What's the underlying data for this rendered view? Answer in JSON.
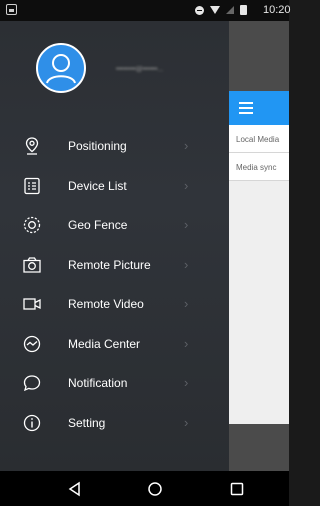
{
  "status_bar": {
    "time": "10:20"
  },
  "drawer": {
    "account": "••••••••@••••••...",
    "menu": [
      {
        "label": "Positioning",
        "icon": "location-pin-icon"
      },
      {
        "label": "Device List",
        "icon": "device-list-icon"
      },
      {
        "label": "Geo Fence",
        "icon": "geo-fence-icon"
      },
      {
        "label": "Remote Picture",
        "icon": "camera-icon"
      },
      {
        "label": "Remote Video",
        "icon": "video-icon"
      },
      {
        "label": "Media Center",
        "icon": "media-center-icon"
      },
      {
        "label": "Notification",
        "icon": "notification-icon"
      },
      {
        "label": "Setting",
        "icon": "info-icon"
      }
    ],
    "chevron": "›"
  },
  "background_app": {
    "rows": [
      "Local Media",
      "Media sync"
    ]
  },
  "colors": {
    "accent": "#2196f3",
    "drawer_bg": "#2c2f34",
    "avatar_bg": "#2f8fe8"
  }
}
